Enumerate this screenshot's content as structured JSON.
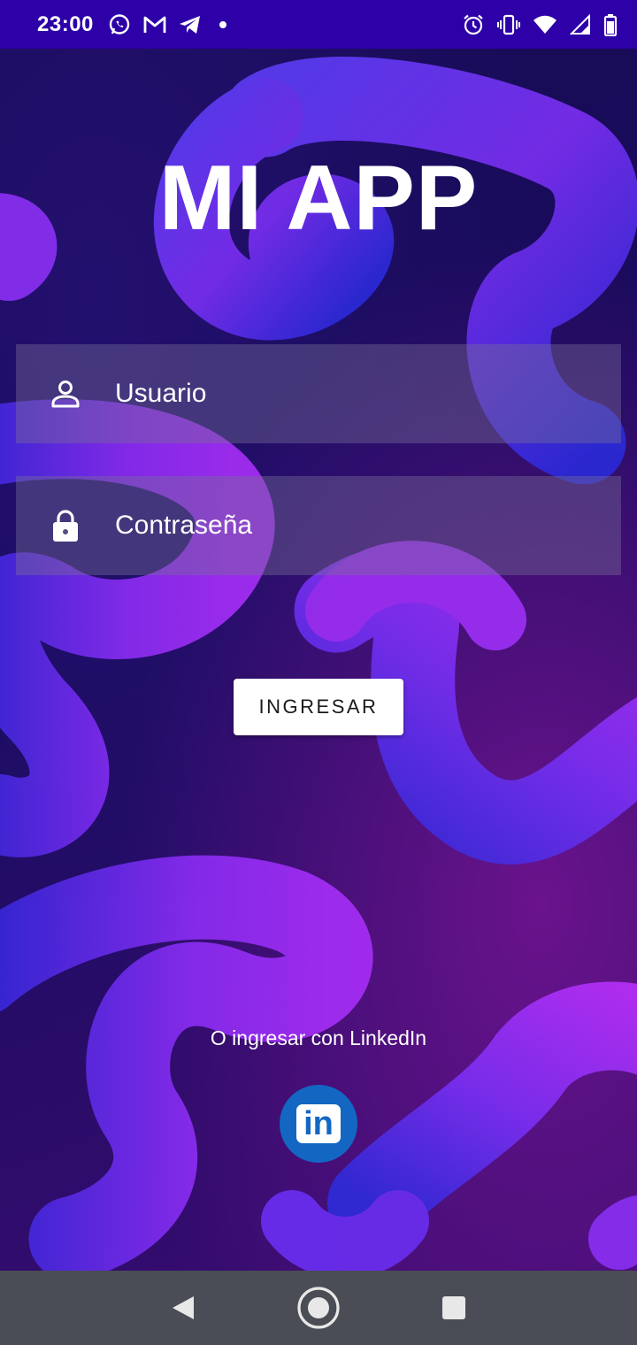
{
  "status_bar": {
    "time": "23:00",
    "left_icons": [
      "whatsapp-icon",
      "gmail-icon",
      "telegram-icon",
      "notification-dot-icon"
    ],
    "right_icons": [
      "alarm-icon",
      "vibrate-icon",
      "wifi-icon",
      "signal-icon",
      "battery-icon"
    ]
  },
  "app": {
    "title": "MI APP"
  },
  "form": {
    "username": {
      "placeholder": "Usuario",
      "icon": "person-icon"
    },
    "password": {
      "placeholder": "Contraseña",
      "icon": "lock-icon"
    },
    "submit_label": "INGRESAR"
  },
  "alt_login": {
    "text": "O ingresar con LinkedIn",
    "linkedin_label": "in"
  },
  "nav_bar": {
    "items": [
      "back-icon",
      "home-icon",
      "recents-icon"
    ]
  },
  "colors": {
    "status_bar": "#2d00a8",
    "nav_bar": "#4a4d55",
    "linkedin_blue": "#1367c2"
  }
}
